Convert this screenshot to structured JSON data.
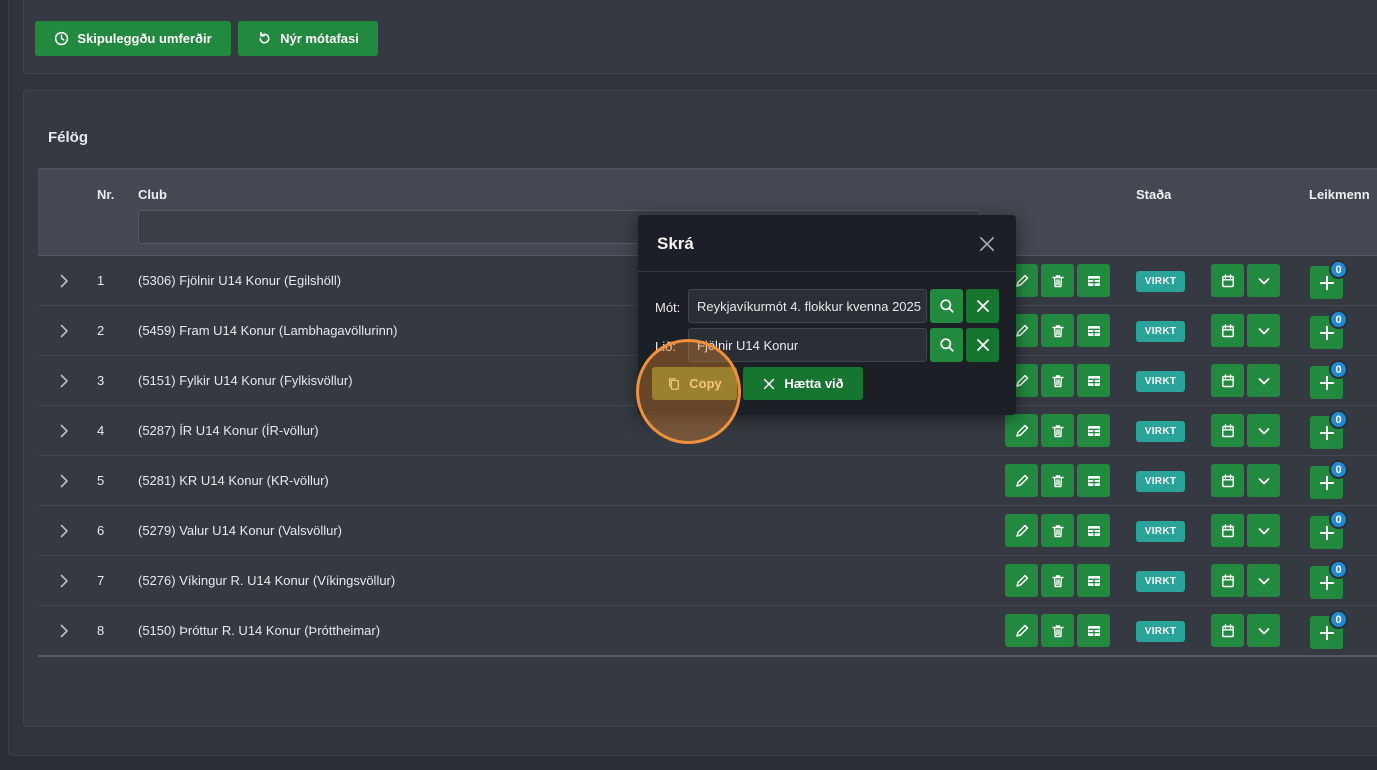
{
  "toolbar": {
    "schedule_label": "Skipuleggðu umferðir",
    "new_phase_label": "Nýr mótafasi"
  },
  "card": {
    "title": "Félög"
  },
  "table": {
    "headers": {
      "nr": "Nr.",
      "club": "Club",
      "status": "Staða",
      "players": "Leikmenn"
    },
    "rows": [
      {
        "nr": "1",
        "club": "(5306) Fjölnir U14 Konur (Egilshöll)",
        "status": "VIRKT",
        "players": "0"
      },
      {
        "nr": "2",
        "club": "(5459) Fram U14 Konur (Lambhagavöllurinn)",
        "status": "VIRKT",
        "players": "0"
      },
      {
        "nr": "3",
        "club": "(5151) Fylkir U14 Konur (Fylkisvöllur)",
        "status": "VIRKT",
        "players": "0"
      },
      {
        "nr": "4",
        "club": "(5287) ÍR U14 Konur (ÍR-völlur)",
        "status": "VIRKT",
        "players": "0"
      },
      {
        "nr": "5",
        "club": "(5281) KR U14 Konur (KR-völlur)",
        "status": "VIRKT",
        "players": "0"
      },
      {
        "nr": "6",
        "club": "(5279) Valur U14 Konur (Valsvöllur)",
        "status": "VIRKT",
        "players": "0"
      },
      {
        "nr": "7",
        "club": "(5276) Víkingur R. U14 Konur (Víkingsvöllur)",
        "status": "VIRKT",
        "players": "0"
      },
      {
        "nr": "8",
        "club": "(5150) Þróttur R. U14 Konur (Þróttheimar)",
        "status": "VIRKT",
        "players": "0"
      }
    ]
  },
  "modal": {
    "title": "Skrá",
    "mot_label": "Mót:",
    "mot_value": "Reykjavíkurmót 4. flokkur kvenna 2025",
    "lid_label": "Lið:",
    "lid_value": "Fjölnir U14 Konur",
    "copy_label": "Copy",
    "cancel_label": "Hætta við"
  },
  "colors": {
    "primary_green": "#228a3f",
    "dark_green": "#16752f",
    "status_teal": "#2aa39a",
    "badge_blue": "#1f8ad6",
    "highlight_orange": "#f0903a"
  }
}
